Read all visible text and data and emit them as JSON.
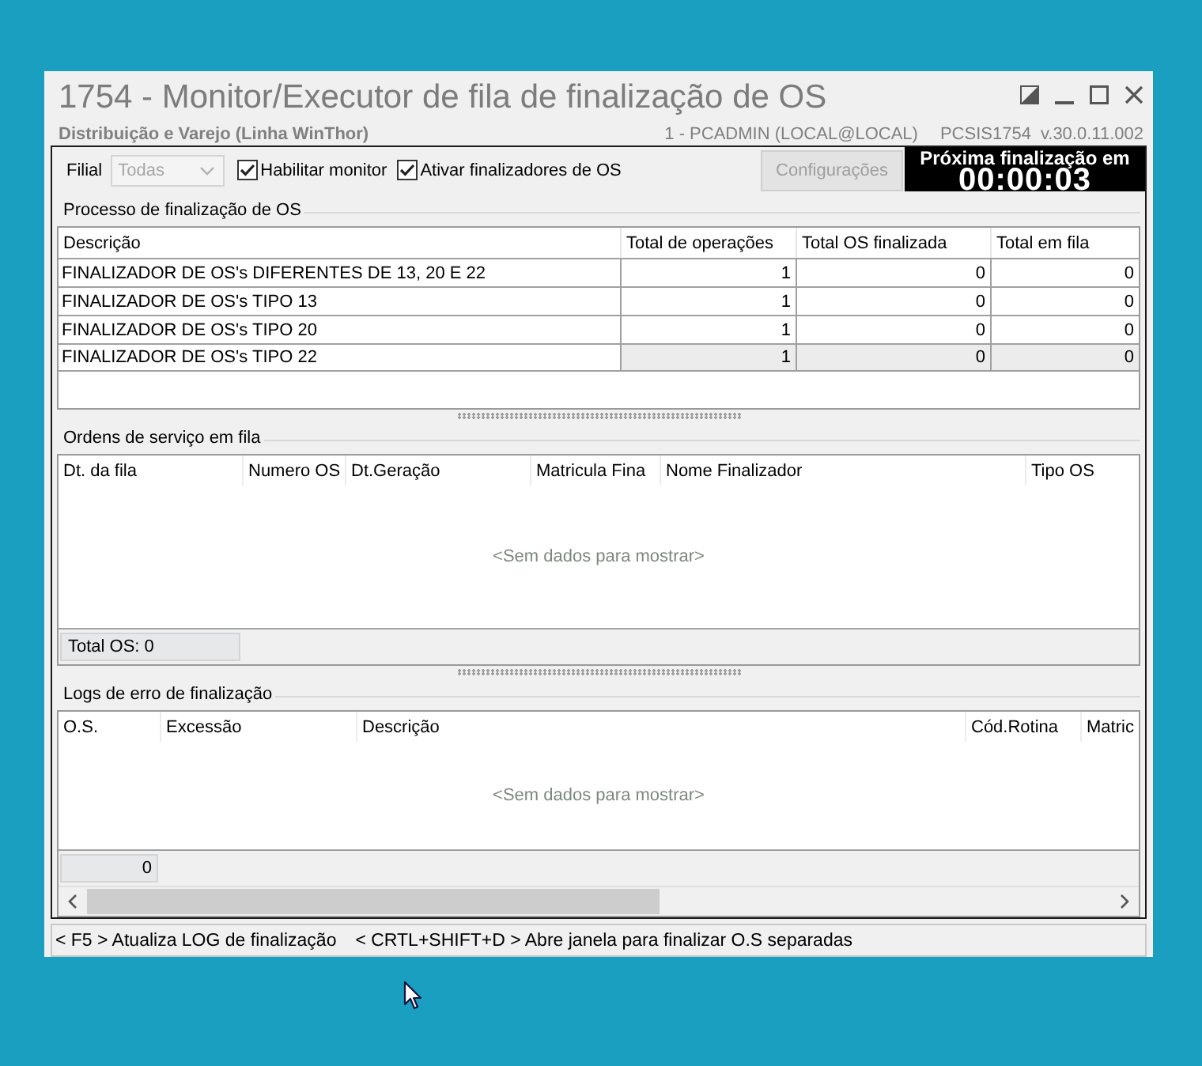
{
  "window": {
    "title": "1754 - Monitor/Executor de fila de finalização de OS",
    "subtitle": "Distribuição e Varejo (Linha WinThor)",
    "user": "1 - PCADMIN (LOCAL@LOCAL)",
    "program": "PCSIS1754",
    "version": "v.30.0.11.002"
  },
  "toolbar": {
    "filial_label": "Filial",
    "filial": {
      "value": "Todas",
      "disabled": true
    },
    "checkboxes": [
      {
        "label": "Habilitar monitor",
        "checked": true
      },
      {
        "label": "Ativar finalizadores de OS",
        "checked": true
      }
    ],
    "config_button": {
      "label": "Configurações",
      "disabled": true
    },
    "timer": {
      "caption": "Próxima finalização em",
      "value": "00:00:03"
    }
  },
  "process_panel": {
    "title": "Processo de finalização de OS",
    "columns": [
      "Descrição",
      "Total de operações",
      "Total OS finalizada",
      "Total em fila"
    ],
    "rows": [
      {
        "cells": [
          "FINALIZADOR DE OS's DIFERENTES DE 13, 20 E 22",
          "1",
          "0",
          "0"
        ],
        "selected": false
      },
      {
        "cells": [
          "FINALIZADOR DE OS's TIPO 13",
          "1",
          "0",
          "0"
        ],
        "selected": false
      },
      {
        "cells": [
          "FINALIZADOR DE OS's TIPO 20",
          "1",
          "0",
          "0"
        ],
        "selected": false
      },
      {
        "cells": [
          "FINALIZADOR DE OS's TIPO 22",
          "1",
          "0",
          "0"
        ],
        "selected": true
      }
    ]
  },
  "queue_panel": {
    "title": "Ordens de serviço em fila",
    "columns": [
      "Dt. da fila",
      "Numero OS",
      "Dt.Geração",
      "Matricula Fina",
      "Nome Finalizador",
      "Tipo OS"
    ],
    "empty_text": "<Sem dados para mostrar>",
    "footer_total": "Total OS: 0"
  },
  "error_panel": {
    "title": "Logs de erro de finalização",
    "columns": [
      "O.S.",
      "Excessão",
      "Descrição",
      "Cód.Rotina",
      "Matric"
    ],
    "empty_text": "<Sem dados para mostrar>",
    "footer_count": "0"
  },
  "status_bar": [
    "< F5 > Atualiza LOG de finalização",
    "< CRTL+SHIFT+D > Abre janela para finalizar O.S separadas"
  ]
}
